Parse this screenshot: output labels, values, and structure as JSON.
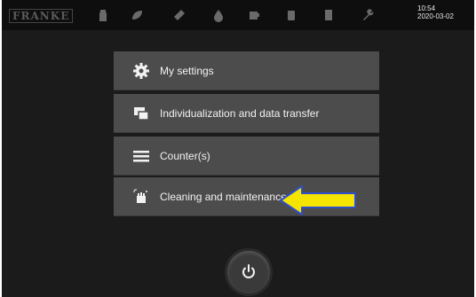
{
  "status_bar": {
    "brand": "FRANKE",
    "time": "10:54",
    "date": "2020-03-02",
    "icons": [
      "product-icon",
      "leaf-icon",
      "grinder-icon",
      "water-drop-icon",
      "cup-icon",
      "milk-icon",
      "card-icon",
      "wrench-icon"
    ]
  },
  "menu": {
    "items": [
      {
        "label": "My settings",
        "icon": "gear-icon"
      },
      {
        "label": "Individualization and data transfer",
        "icon": "transfer-icon"
      },
      {
        "label": "Counter(s)",
        "icon": "menu-lines-icon"
      },
      {
        "label": "Cleaning and maintenance",
        "icon": "cleaning-hand-icon"
      }
    ]
  },
  "annotation": {
    "arrow_color": "#f5e400",
    "arrow_outline": "#2f4fd0",
    "points_to": "Cleaning and maintenance"
  },
  "power_button": {
    "icon": "power-icon"
  },
  "colors": {
    "background": "#1b1b1b",
    "menu_item": "#4c4c4c",
    "text": "#f2f2f2"
  }
}
